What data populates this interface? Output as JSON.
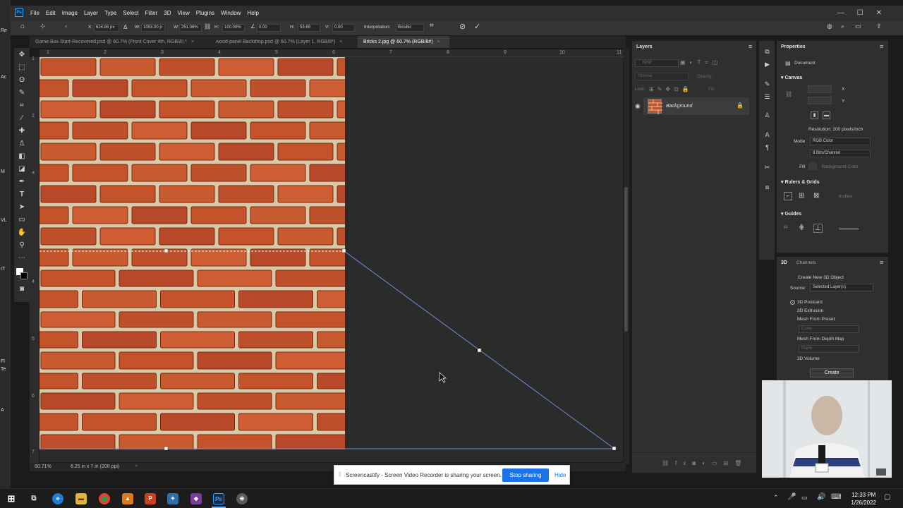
{
  "desktop_strip": {
    "labels": [
      "Re",
      "Ac",
      "M",
      "VL",
      "IT",
      "Fl",
      "Te",
      "A"
    ]
  },
  "app": {
    "logo": "Ps",
    "menu": [
      "File",
      "Edit",
      "Image",
      "Layer",
      "Type",
      "Select",
      "Filter",
      "3D",
      "View",
      "Plugins",
      "Window",
      "Help"
    ],
    "window_controls": {
      "minimize": "—",
      "maximize": "☐",
      "close": "✕"
    }
  },
  "options_bar": {
    "x_label": "X:",
    "x_value": "624.86 px",
    "w_label": "W:",
    "w_value": "1053.00 p",
    "w_pct_label": "W:",
    "w_pct_value": "251.06%",
    "h_label": "H:",
    "h_value": "100.00%",
    "angle_value": "0.00",
    "h_skew_label": "H:",
    "h_skew_value": "53.69",
    "v_skew_label": "V:",
    "v_skew_value": "0.00",
    "interp_label": "Interpolation:",
    "interp_value": "Bicubic"
  },
  "tabs": [
    {
      "label": "Game Box Start-Recovered.psd @ 60.7% (Front Cover 4th, RGB/8) *",
      "close": "×",
      "active": false
    },
    {
      "label": "wood-panel Backdrop.psd @ 60.7% (Layer 1, RGB/8*)",
      "close": "×",
      "active": false
    },
    {
      "label": "Bricks 2.jpg @ 60.7% (RGB/8#)",
      "close": "×",
      "active": true
    }
  ],
  "ruler": {
    "top": [
      "1",
      "2",
      "3",
      "4",
      "5",
      "6",
      "7",
      "8",
      "9",
      "10",
      "11"
    ],
    "left": [
      "1",
      "2",
      "3",
      "4",
      "5",
      "6",
      "7"
    ]
  },
  "status": {
    "zoom": "60.71%",
    "doc_info": "6.25 in x 7 in (200 ppi)"
  },
  "layers_panel": {
    "title": "Layers",
    "kind_placeholder": "Kind",
    "blend_mode": "Normal",
    "opacity_label": "Opacity:",
    "lock_label": "Lock:",
    "fill_label": "Fill:",
    "layer_name": "Background"
  },
  "properties_panel": {
    "title": "Properties",
    "doc_label": "Document",
    "canvas_section": "Canvas",
    "x_label": "X",
    "y_label": "Y",
    "resolution": "Resolution: 200 pixels/inch",
    "mode_label": "Mode",
    "mode_value": "RGB Color",
    "depth_value": "8 Bits/Channel",
    "fill_label": "Fill",
    "fill_value": "Background Color",
    "rulers_section": "Rulers & Grids",
    "rulers_unit": "Inches",
    "guides_section": "Guides"
  },
  "panel_3d": {
    "tab_3d": "3D",
    "tab_channels": "Channels",
    "create_label": "Create New 3D Object",
    "source_label": "Source:",
    "source_value": "Selected Layer(s)",
    "options": [
      "3D Postcard",
      "3D Extrusion",
      "Mesh From Preset",
      "Mesh From Depth Map",
      "3D Volume"
    ],
    "preset_value": "Cone",
    "depth_value": "Plane",
    "create_button": "Create"
  },
  "screencastify": {
    "handle": "||",
    "message": "Screencastify - Screen Video Recorder is sharing your screen.",
    "stop_button": "Stop sharing",
    "hide_link": "Hide"
  },
  "taskbar": {
    "time": "12:33 PM",
    "date": "1/26/2022"
  },
  "colors": {
    "accent": "#31a8ff",
    "brick": "#c4532c",
    "mortar": "#d8c9a8",
    "stop_button": "#1a73e8"
  }
}
